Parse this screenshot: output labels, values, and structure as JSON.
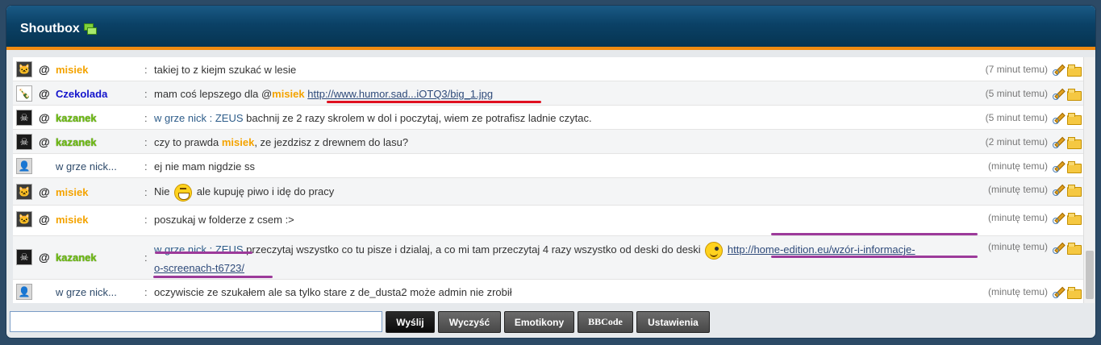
{
  "header": {
    "title": "Shoutbox"
  },
  "messages": [
    {
      "avatar": "cat-avatar",
      "at": "@",
      "nick": "misiek",
      "text": "takiej to z kiejm szukać w lesie",
      "time": "(7 minut temu)"
    },
    {
      "avatar": "bottle-avatar",
      "at": "@",
      "nick": "Czekolada",
      "text_pre": "mam coś lepszego dla @",
      "mention": "misiek",
      "link": "http://www.humor.sad...iOTQ3/big_1.jpg",
      "time": "(5 minut temu)"
    },
    {
      "avatar": "skull-avatar",
      "at": "@",
      "nick": "kazanek",
      "prefix": "w grze nick : ZEUS",
      "text": " bachnij ze 2 razy skrolem w dol i poczytaj, wiem ze potrafisz ladnie czytac.",
      "time": "(5 minut temu)"
    },
    {
      "avatar": "skull-avatar",
      "at": "@",
      "nick": "kazanek",
      "text_pre": "czy to prawda ",
      "mention": "misiek",
      "text_post": ", ze jezdzisz z drewnem do lasu?",
      "time": "(2 minut temu)"
    },
    {
      "avatar": "default-avatar",
      "nick": "w grze nick...",
      "text": "ej nie mam nigdzie ss",
      "time": "(minutę temu)"
    },
    {
      "avatar": "cat-avatar",
      "at": "@",
      "nick": "misiek",
      "text_pre": "Nie ",
      "text_post": " ale kupuję piwo i idę do pracy",
      "time": "(minutę temu)"
    },
    {
      "avatar": "cat-avatar",
      "at": "@",
      "nick": "misiek",
      "text": "poszukaj w folderze z csem :>",
      "time": "(minutę temu)"
    },
    {
      "avatar": "skull-avatar",
      "at": "@",
      "nick": "kazanek",
      "prefix": "w grze nick : ZEUS",
      "text": " przeczytaj wszystko co tu pisze i dzialaj, a co mi tam przeczytaj 4 razy wszystko od deski do deski ",
      "link": "http://home-edition.eu/wzór-i-informacje-",
      "link_cont": "o-screenach-t6723/",
      "time": "(minutę temu)"
    },
    {
      "avatar": "default-avatar",
      "nick": "w grze nick...",
      "text": "oczywiscie ze szukałem ale sa tylko stare z de_dusta2 może admin nie zrobił",
      "time": "(minutę temu)"
    }
  ],
  "input": {
    "value": "",
    "placeholder": ""
  },
  "buttons": {
    "send": "Wyślij",
    "clear": "Wyczyść",
    "emoticons": "Emotikony",
    "bbcode": "BBCode",
    "settings": "Ustawienia"
  },
  "colors": {
    "header": "#0b4166",
    "accent": "#f08a10",
    "nick_orange": "#f4a300",
    "nick_blue": "#1414cc",
    "nick_green": "#6dbb10",
    "annotation_red": "#e01020",
    "annotation_purple": "#9c3a9a"
  }
}
